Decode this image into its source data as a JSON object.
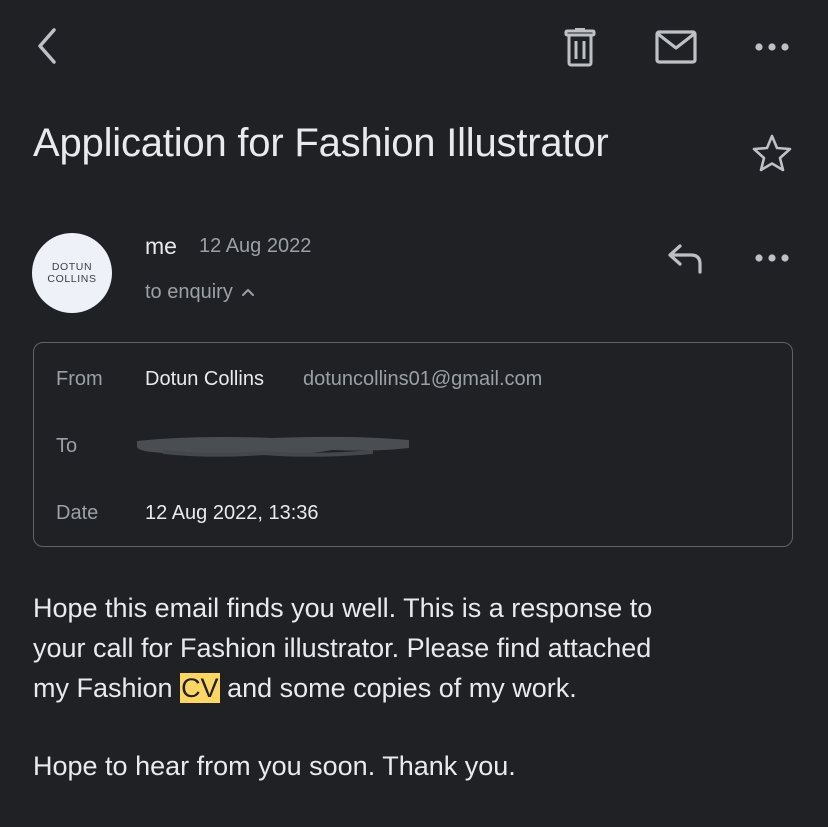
{
  "toolbar": {
    "back_icon": "chevron-left-icon",
    "delete_icon": "trash-icon",
    "mark_unread_icon": "mail-icon",
    "more_icon": "more-horizontal-icon"
  },
  "email": {
    "subject": "Application for Fashion Illustrator",
    "star_icon": "star-outline-icon",
    "avatar": {
      "line1": "DOTUN",
      "line2": "COLLINS",
      "background": "#eef1f8"
    },
    "sender": "me",
    "date": "12 Aug 2022",
    "recipient_summary": "to enquiry",
    "details": {
      "from_label": "From",
      "from_name": "Dotun Collins",
      "from_email": "dotuncollins01@gmail.com",
      "to_label": "To",
      "to_value_redacted": true,
      "date_label": "Date",
      "date_value": "12 Aug 2022, 13:36"
    },
    "body": {
      "p1_line1": "Hope this email finds you well. This is a response to",
      "p1_line2": "your call for Fashion illustrator. Please find attached",
      "p1_line3_pre": "my Fashion ",
      "p1_line3_highlight": "CV",
      "p1_line3_post": " and some copies of my work.",
      "p2": "Hope to hear from you soon. Thank you."
    }
  },
  "colors": {
    "background": "#202124",
    "text_primary": "#e8eaed",
    "text_secondary": "#9aa0a6",
    "border": "#5f6368",
    "highlight": "#fdd663"
  }
}
